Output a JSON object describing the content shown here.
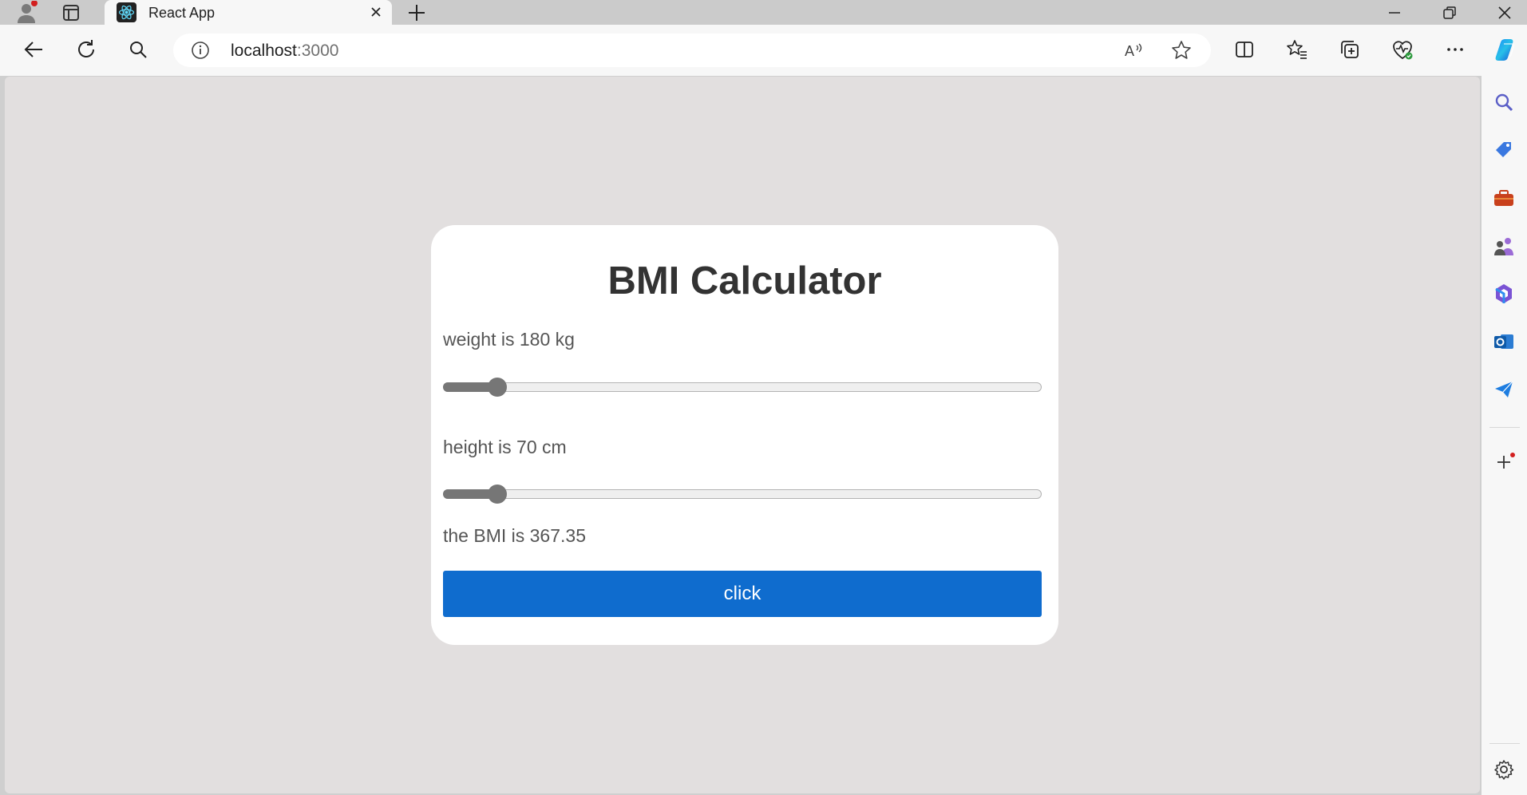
{
  "browser": {
    "tab": {
      "title": "React App"
    },
    "omnibox": {
      "host": "localhost",
      "port": ":3000"
    }
  },
  "colors": {
    "button": "#0f6cce",
    "card": "#ffffff",
    "page_bg": "#e2dfdf",
    "slider": "#767676"
  },
  "app": {
    "title": "BMI Calculator",
    "weight_label": "weight is 180 kg",
    "weight_slider": {
      "value": 180,
      "fraction": 0.077
    },
    "height_label": "height is 70 cm",
    "height_slider": {
      "value": 70,
      "fraction": 0.077
    },
    "bmi_text": "the BMI is 367.35",
    "button_label": "click"
  },
  "icons": {
    "titlebar": [
      "profile-icon",
      "tab-actions-icon",
      "react-favicon-icon",
      "close-tab-icon",
      "new-tab-icon",
      "minimize-icon",
      "restore-icon",
      "close-window-icon"
    ],
    "toolbar": [
      "back-icon",
      "refresh-icon",
      "search-icon",
      "info-icon",
      "read-aloud-icon",
      "favorite-star-icon",
      "split-screen-icon",
      "favorites-icon",
      "collections-icon",
      "browser-essentials-icon",
      "more-icon",
      "copilot-icon"
    ],
    "sidebar": [
      "search-icon",
      "shopping-tag-icon",
      "tools-icon",
      "games-icon",
      "microsoft-365-icon",
      "outlook-icon",
      "send-icon",
      "add-icon",
      "settings-icon"
    ]
  }
}
